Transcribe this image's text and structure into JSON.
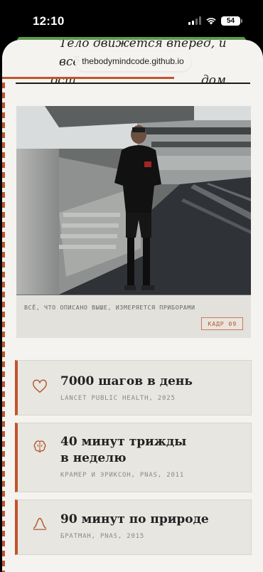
{
  "status": {
    "time": "12:10",
    "battery": "54"
  },
  "hero": {
    "line1": "Тело движется вперёд, и всё",
    "line2_left": "ост",
    "line2_right": "дом."
  },
  "browser": {
    "url": "thebodymindcode.github.io"
  },
  "photo_card": {
    "caption": "ВСЁ, ЧТО ОПИСАНО ВЫШЕ, ИЗМЕРЯЕТСЯ ПРИБОРАМИ",
    "badge": "КАДР 09"
  },
  "facts": [
    {
      "icon": "heart-icon",
      "title": "7000 шагов в день",
      "source": "LANCET PUBLIC HEALTH, 2025"
    },
    {
      "icon": "brain-icon",
      "title_line1": "40 минут трижды",
      "title_line2": "в неделю",
      "source": "КРАМЕР И ЭРИКСОН, PNAS, 2011"
    },
    {
      "icon": "wave-icon",
      "title": "90 минут по природе",
      "source": "БРАТМАН, PNAS, 2015"
    }
  ],
  "colors": {
    "accent": "#c0552c",
    "page_bg": "#f4f3ef",
    "card_bg": "#e7e6e1"
  }
}
